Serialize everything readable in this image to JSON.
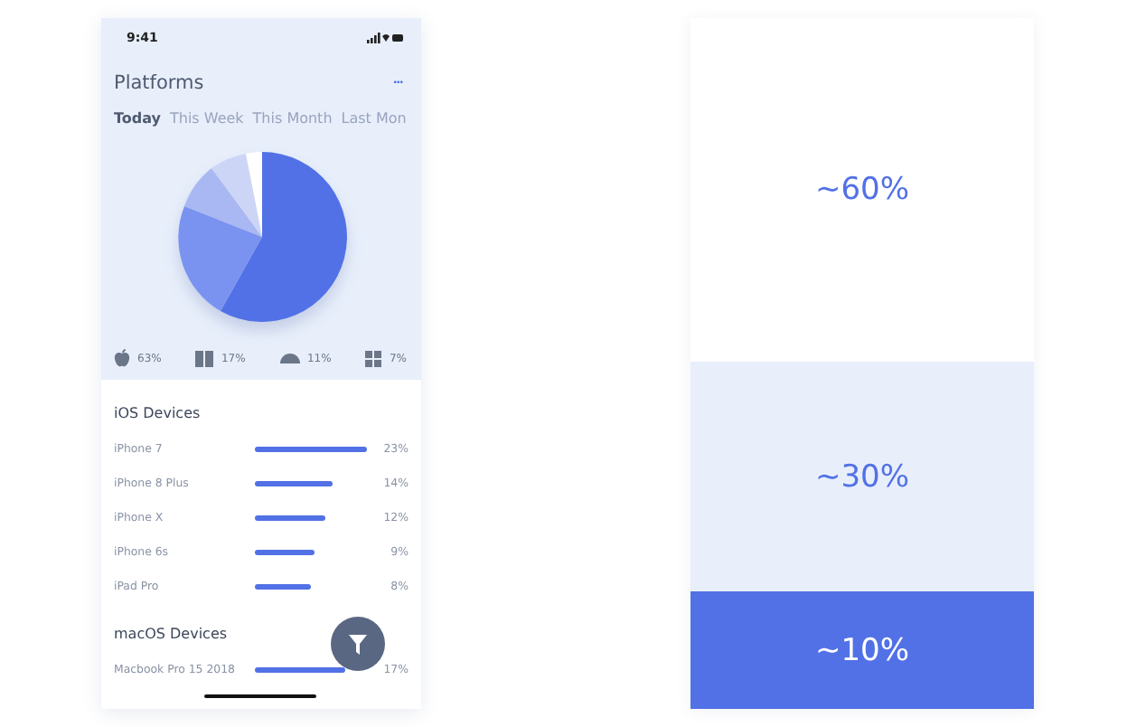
{
  "phone": {
    "status_bar": {
      "time": "9:41"
    },
    "title": "Platforms",
    "menu": "•••",
    "tabs": [
      {
        "label": "Today",
        "selected": true
      },
      {
        "label": "This Week",
        "selected": false
      },
      {
        "label": "This Month",
        "selected": false
      },
      {
        "label": "Last Mon",
        "selected": false
      }
    ],
    "legend": [
      {
        "kind": "apple",
        "value": "63%"
      },
      {
        "kind": "book",
        "value": "17%"
      },
      {
        "kind": "cloud",
        "value": "11%"
      },
      {
        "kind": "windows",
        "value": "7%"
      }
    ],
    "sections": [
      {
        "title": "iOS Devices",
        "rows": [
          {
            "name": "iPhone 7",
            "value": "23%"
          },
          {
            "name": "iPhone 8 Plus",
            "value": "14%"
          },
          {
            "name": "iPhone X",
            "value": "12%"
          },
          {
            "name": "iPhone 6s",
            "value": "9%"
          },
          {
            "name": "iPad Pro",
            "value": "8%"
          }
        ]
      },
      {
        "title": "macOS Devices",
        "rows": [
          {
            "name": "Macbook Pro 15 2018",
            "value": "17%"
          }
        ]
      }
    ]
  },
  "proportions": [
    {
      "label": "~60%",
      "color": "#ffffff"
    },
    {
      "label": "~30%",
      "color": "#e8effb"
    },
    {
      "label": "~10%",
      "color": "#5271e6"
    }
  ]
}
